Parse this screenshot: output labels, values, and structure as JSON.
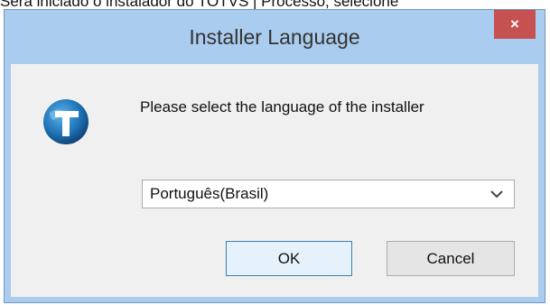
{
  "background": {
    "caption": "Será iniciado o instalador do TOTVS | Processo, selecione"
  },
  "window": {
    "title": "Installer Language",
    "close_label": "×",
    "close_color": "#c75050",
    "frame_color": "#aaccef"
  },
  "dialog": {
    "prompt": "Please select the language of the installer",
    "app_icon": "totvs-logo-icon",
    "language_select": {
      "selected": "Português(Brasil)",
      "arrow_icon": "chevron-down-icon"
    },
    "buttons": {
      "ok": "OK",
      "cancel": "Cancel"
    }
  }
}
